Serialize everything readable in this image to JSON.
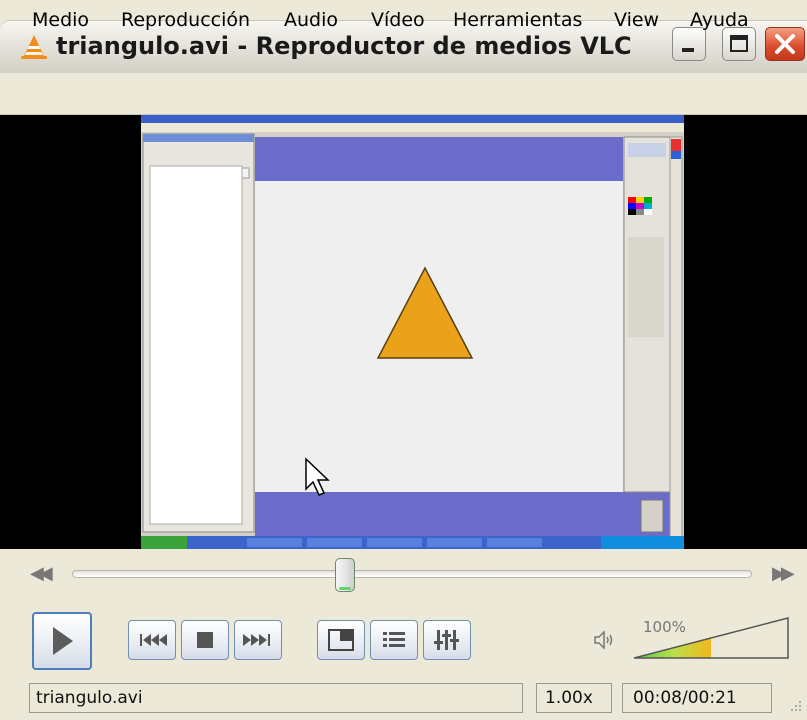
{
  "window": {
    "title": "triangulo.avi - Reproductor de medios VLC",
    "controls": [
      "minimize-icon",
      "maximize-icon",
      "close-icon"
    ]
  },
  "menu": {
    "items": [
      "Medio",
      "Reproducción",
      "Audio",
      "Vídeo",
      "Herramientas",
      "View",
      "Ayuda"
    ]
  },
  "video": {
    "shape_fill": "#e9a21a",
    "band_color": "#6b6bc9",
    "canvas_color": "#efefef"
  },
  "controls": {
    "seek_position": 0.38,
    "buttons": [
      "play-icon",
      "previous-icon",
      "stop-icon",
      "next-icon",
      "fullscreen-icon",
      "playlist-icon",
      "equalizer-icon"
    ]
  },
  "volume": {
    "label": "100%",
    "level": 1.0,
    "icon": "speaker-icon"
  },
  "status": {
    "filename": "triangulo.avi",
    "speed": "1.00x",
    "time": "00:08/00:21"
  }
}
